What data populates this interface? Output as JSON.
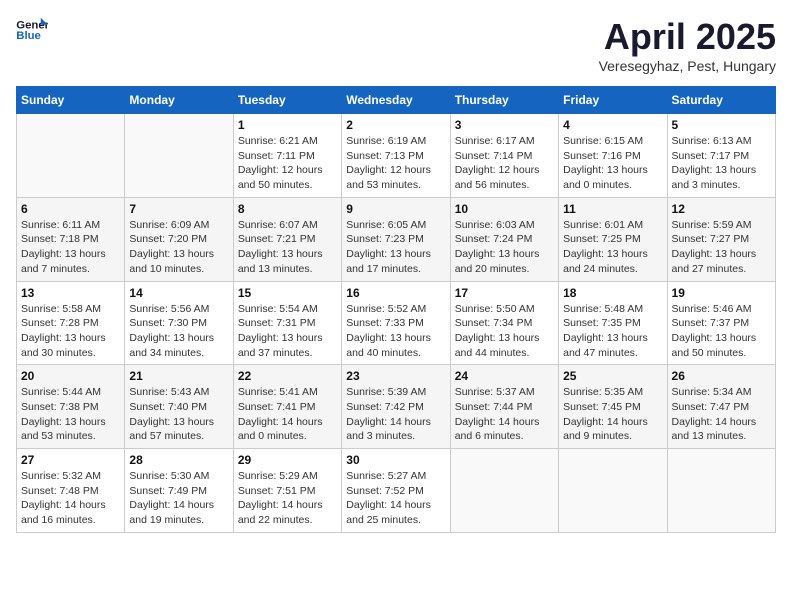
{
  "header": {
    "logo_line1": "General",
    "logo_line2": "Blue",
    "month": "April 2025",
    "location": "Veresegyhaz, Pest, Hungary"
  },
  "weekdays": [
    "Sunday",
    "Monday",
    "Tuesday",
    "Wednesday",
    "Thursday",
    "Friday",
    "Saturday"
  ],
  "weeks": [
    [
      {
        "day": "",
        "detail": ""
      },
      {
        "day": "",
        "detail": ""
      },
      {
        "day": "1",
        "detail": "Sunrise: 6:21 AM\nSunset: 7:11 PM\nDaylight: 12 hours\nand 50 minutes."
      },
      {
        "day": "2",
        "detail": "Sunrise: 6:19 AM\nSunset: 7:13 PM\nDaylight: 12 hours\nand 53 minutes."
      },
      {
        "day": "3",
        "detail": "Sunrise: 6:17 AM\nSunset: 7:14 PM\nDaylight: 12 hours\nand 56 minutes."
      },
      {
        "day": "4",
        "detail": "Sunrise: 6:15 AM\nSunset: 7:16 PM\nDaylight: 13 hours\nand 0 minutes."
      },
      {
        "day": "5",
        "detail": "Sunrise: 6:13 AM\nSunset: 7:17 PM\nDaylight: 13 hours\nand 3 minutes."
      }
    ],
    [
      {
        "day": "6",
        "detail": "Sunrise: 6:11 AM\nSunset: 7:18 PM\nDaylight: 13 hours\nand 7 minutes."
      },
      {
        "day": "7",
        "detail": "Sunrise: 6:09 AM\nSunset: 7:20 PM\nDaylight: 13 hours\nand 10 minutes."
      },
      {
        "day": "8",
        "detail": "Sunrise: 6:07 AM\nSunset: 7:21 PM\nDaylight: 13 hours\nand 13 minutes."
      },
      {
        "day": "9",
        "detail": "Sunrise: 6:05 AM\nSunset: 7:23 PM\nDaylight: 13 hours\nand 17 minutes."
      },
      {
        "day": "10",
        "detail": "Sunrise: 6:03 AM\nSunset: 7:24 PM\nDaylight: 13 hours\nand 20 minutes."
      },
      {
        "day": "11",
        "detail": "Sunrise: 6:01 AM\nSunset: 7:25 PM\nDaylight: 13 hours\nand 24 minutes."
      },
      {
        "day": "12",
        "detail": "Sunrise: 5:59 AM\nSunset: 7:27 PM\nDaylight: 13 hours\nand 27 minutes."
      }
    ],
    [
      {
        "day": "13",
        "detail": "Sunrise: 5:58 AM\nSunset: 7:28 PM\nDaylight: 13 hours\nand 30 minutes."
      },
      {
        "day": "14",
        "detail": "Sunrise: 5:56 AM\nSunset: 7:30 PM\nDaylight: 13 hours\nand 34 minutes."
      },
      {
        "day": "15",
        "detail": "Sunrise: 5:54 AM\nSunset: 7:31 PM\nDaylight: 13 hours\nand 37 minutes."
      },
      {
        "day": "16",
        "detail": "Sunrise: 5:52 AM\nSunset: 7:33 PM\nDaylight: 13 hours\nand 40 minutes."
      },
      {
        "day": "17",
        "detail": "Sunrise: 5:50 AM\nSunset: 7:34 PM\nDaylight: 13 hours\nand 44 minutes."
      },
      {
        "day": "18",
        "detail": "Sunrise: 5:48 AM\nSunset: 7:35 PM\nDaylight: 13 hours\nand 47 minutes."
      },
      {
        "day": "19",
        "detail": "Sunrise: 5:46 AM\nSunset: 7:37 PM\nDaylight: 13 hours\nand 50 minutes."
      }
    ],
    [
      {
        "day": "20",
        "detail": "Sunrise: 5:44 AM\nSunset: 7:38 PM\nDaylight: 13 hours\nand 53 minutes."
      },
      {
        "day": "21",
        "detail": "Sunrise: 5:43 AM\nSunset: 7:40 PM\nDaylight: 13 hours\nand 57 minutes."
      },
      {
        "day": "22",
        "detail": "Sunrise: 5:41 AM\nSunset: 7:41 PM\nDaylight: 14 hours\nand 0 minutes."
      },
      {
        "day": "23",
        "detail": "Sunrise: 5:39 AM\nSunset: 7:42 PM\nDaylight: 14 hours\nand 3 minutes."
      },
      {
        "day": "24",
        "detail": "Sunrise: 5:37 AM\nSunset: 7:44 PM\nDaylight: 14 hours\nand 6 minutes."
      },
      {
        "day": "25",
        "detail": "Sunrise: 5:35 AM\nSunset: 7:45 PM\nDaylight: 14 hours\nand 9 minutes."
      },
      {
        "day": "26",
        "detail": "Sunrise: 5:34 AM\nSunset: 7:47 PM\nDaylight: 14 hours\nand 13 minutes."
      }
    ],
    [
      {
        "day": "27",
        "detail": "Sunrise: 5:32 AM\nSunset: 7:48 PM\nDaylight: 14 hours\nand 16 minutes."
      },
      {
        "day": "28",
        "detail": "Sunrise: 5:30 AM\nSunset: 7:49 PM\nDaylight: 14 hours\nand 19 minutes."
      },
      {
        "day": "29",
        "detail": "Sunrise: 5:29 AM\nSunset: 7:51 PM\nDaylight: 14 hours\nand 22 minutes."
      },
      {
        "day": "30",
        "detail": "Sunrise: 5:27 AM\nSunset: 7:52 PM\nDaylight: 14 hours\nand 25 minutes."
      },
      {
        "day": "",
        "detail": ""
      },
      {
        "day": "",
        "detail": ""
      },
      {
        "day": "",
        "detail": ""
      }
    ]
  ]
}
